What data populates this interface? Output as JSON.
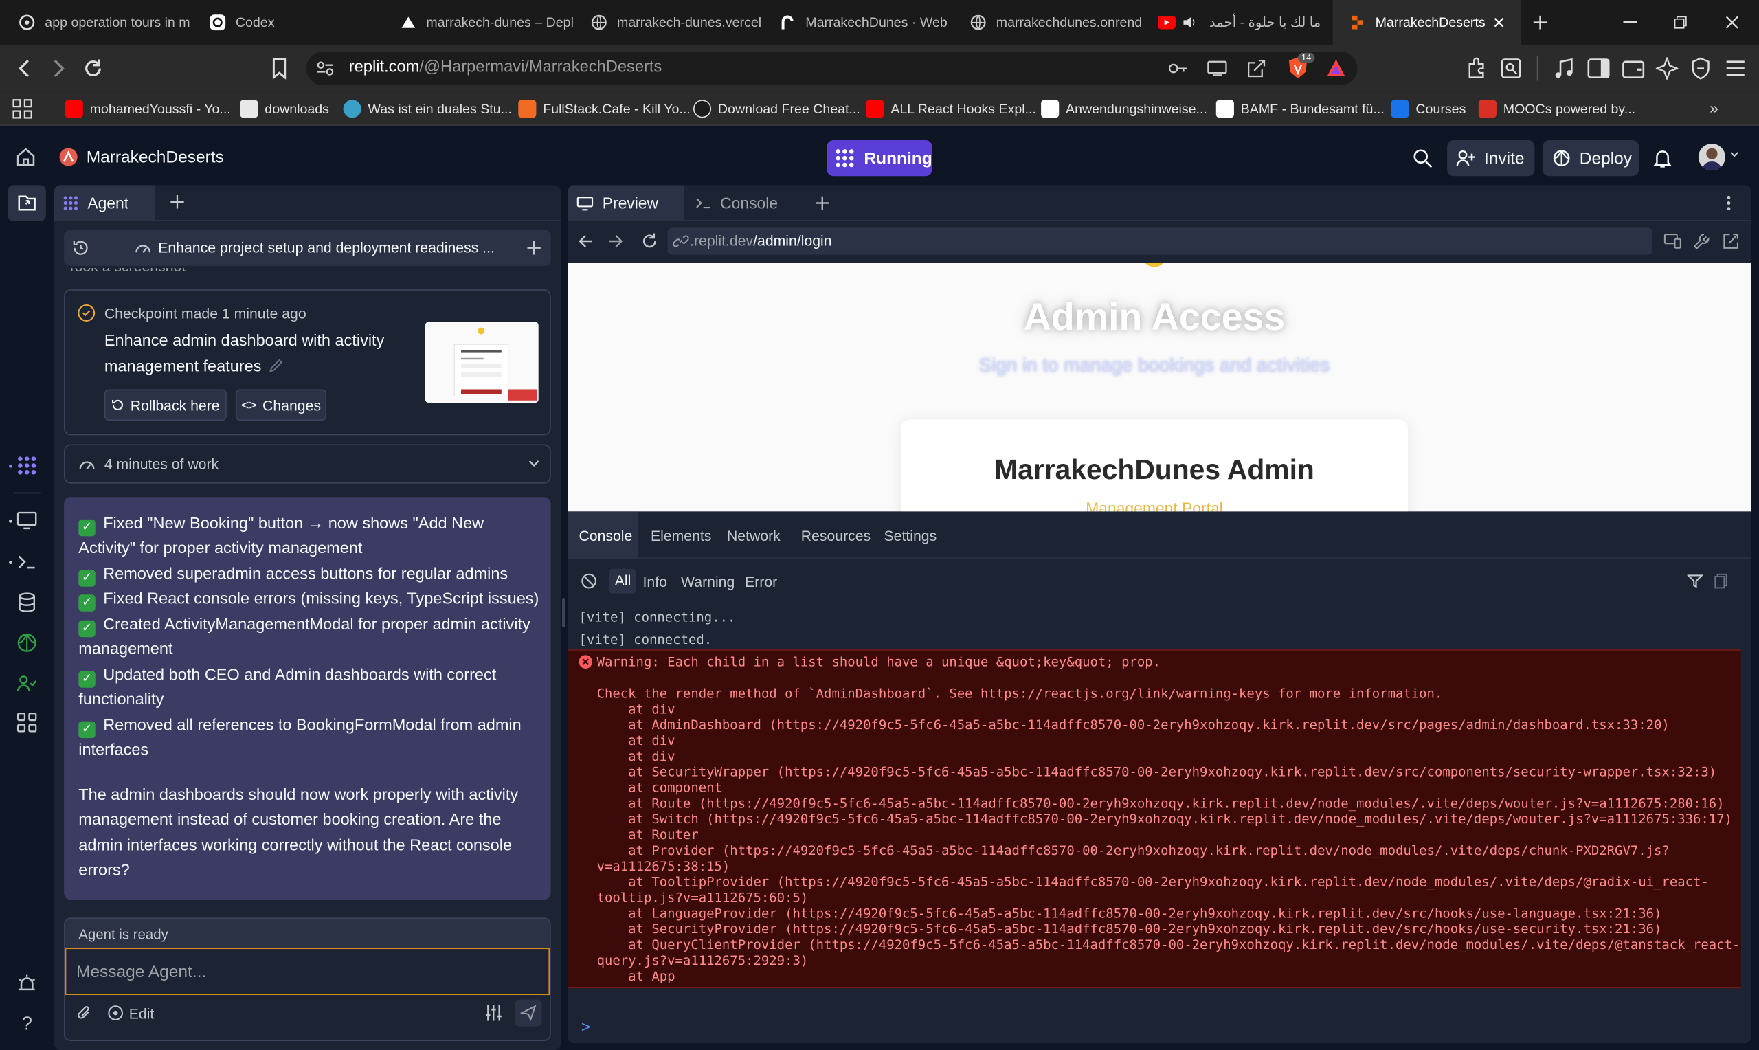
{
  "browser": {
    "tabs": [
      {
        "title": "app operation tours in m",
        "icon": "openai-icon"
      },
      {
        "title": "Codex",
        "icon": "openai-icon"
      },
      {
        "title": "marrakech-dunes – Depl",
        "icon": "vercel-icon"
      },
      {
        "title": "marrakech-dunes.vercel",
        "icon": "globe-icon"
      },
      {
        "title": "MarrakechDunes · Web",
        "icon": "render-icon"
      },
      {
        "title": "marrakechdunes.onrend",
        "icon": "globe-icon"
      },
      {
        "title": "ما لك يا حلوة - أحمد",
        "icon": "youtube-icon"
      },
      {
        "title": "MarrakechDeserts",
        "icon": "replit-icon"
      }
    ],
    "url_host": "replit.com",
    "url_path": "/@Harpermavi/MarrakechDeserts",
    "shield_count": "14",
    "bookmarks": [
      {
        "label": "mohamedYoussfi - Yo...",
        "color": "#ff0000"
      },
      {
        "label": "downloads",
        "color": "#ffffff"
      },
      {
        "label": "Was ist ein duales Stu...",
        "color": "#3aa0c8"
      },
      {
        "label": "FullStack.Cafe - Kill Yo...",
        "color": "#f26b22"
      },
      {
        "label": "Download Free Cheat...",
        "color": "#2b2b2b"
      },
      {
        "label": "ALL React Hooks Expl...",
        "color": "#ff0000"
      },
      {
        "label": "Anwendungshinweise...",
        "color": "#ffffff"
      },
      {
        "label": "BAMF - Bundesamt fü...",
        "color": "#ffffff"
      },
      {
        "label": "Courses",
        "color": "#1a73e8"
      },
      {
        "label": "MOOCs powered by...",
        "color": "#d93025"
      }
    ]
  },
  "replit": {
    "project_name": "MarrakechDeserts",
    "run_label": "Running",
    "invite_label": "Invite",
    "deploy_label": "Deploy",
    "accent": "#5b3ed6"
  },
  "agent": {
    "tab_label": "Agent",
    "thread_title": "Enhance project setup and deployment readiness ...",
    "faded_text": "Took a screenshot",
    "checkpoint_label": "Checkpoint made 1 minute ago",
    "checkpoint_title_1": "Enhance admin dashboard with activity",
    "checkpoint_title_2": "management features",
    "rollback_label": "Rollback here",
    "changes_label": "Changes",
    "work_label": "4 minutes of work",
    "message_lines": [
      "Fixed \"New Booking\" button → now shows \"Add New",
      "Activity\" for proper activity management",
      "Removed superadmin access buttons for regular admins",
      "Fixed React console errors (missing keys, TypeScript issues)",
      "Created ActivityManagementModal for proper admin activity",
      "management",
      "Updated both CEO and Admin dashboards with correct",
      "functionality",
      "Removed all references to BookingFormModal from admin",
      "interfaces"
    ],
    "summary_lines": [
      "The admin dashboards should now work properly with activity",
      "management instead of customer booking creation. Are the",
      "admin interfaces working correctly without the React console",
      "errors?"
    ],
    "status": "Agent is ready",
    "input_placeholder": "Message Agent...",
    "edit_label": "Edit"
  },
  "preview": {
    "tab_preview": "Preview",
    "tab_console": "Console",
    "url_prefix": ".replit.dev",
    "url_path": "/admin/login",
    "heading": "Admin Access",
    "subheading": "Sign in to manage bookings and activities",
    "card_title": "MarrakechDunes Admin",
    "card_sub": "Management Portal"
  },
  "devtools": {
    "tabs": [
      "Console",
      "Elements",
      "Network",
      "Resources",
      "Settings"
    ],
    "filters": [
      "All",
      "Info",
      "Warning",
      "Error"
    ],
    "log": [
      "[vite] connecting...",
      "[vite] connected."
    ],
    "error_title": "Warning: Each child in a list should have a unique &quot;key&quot; prop.",
    "error_lines": [
      "Check the render method of `AdminDashboard`. See https://reactjs.org/link/warning-keys for more information.",
      "    at div",
      "    at AdminDashboard (https://4920f9c5-5fc6-45a5-a5bc-114adffc8570-00-2eryh9xohzoqy.kirk.replit.dev/src/pages/admin/dashboard.tsx:33:20)",
      "    at div",
      "    at div",
      "    at SecurityWrapper (https://4920f9c5-5fc6-45a5-a5bc-114adffc8570-00-2eryh9xohzoqy.kirk.replit.dev/src/components/security-wrapper.tsx:32:3)",
      "    at component",
      "    at Route (https://4920f9c5-5fc6-45a5-a5bc-114adffc8570-00-2eryh9xohzoqy.kirk.replit.dev/node_modules/.vite/deps/wouter.js?v=a1112675:280:16)",
      "    at Switch (https://4920f9c5-5fc6-45a5-a5bc-114adffc8570-00-2eryh9xohzoqy.kirk.replit.dev/node_modules/.vite/deps/wouter.js?v=a1112675:336:17)",
      "    at Router",
      "    at Provider (https://4920f9c5-5fc6-45a5-a5bc-114adffc8570-00-2eryh9xohzoqy.kirk.replit.dev/node_modules/.vite/deps/chunk-PXD2RGV7.js?",
      "v=a1112675:38:15)",
      "    at TooltipProvider (https://4920f9c5-5fc6-45a5-a5bc-114adffc8570-00-2eryh9xohzoqy.kirk.replit.dev/node_modules/.vite/deps/@radix-ui_react-",
      "tooltip.js?v=a1112675:60:5)",
      "    at LanguageProvider (https://4920f9c5-5fc6-45a5-a5bc-114adffc8570-00-2eryh9xohzoqy.kirk.replit.dev/src/hooks/use-language.tsx:21:36)",
      "    at SecurityProvider (https://4920f9c5-5fc6-45a5-a5bc-114adffc8570-00-2eryh9xohzoqy.kirk.replit.dev/src/hooks/use-security.tsx:21:36)",
      "    at QueryClientProvider (https://4920f9c5-5fc6-45a5-a5bc-114adffc8570-00-2eryh9xohzoqy.kirk.replit.dev/node_modules/.vite/deps/@tanstack_react-",
      "query.js?v=a1112675:2929:3)",
      "    at App"
    ],
    "prompt": ">"
  }
}
